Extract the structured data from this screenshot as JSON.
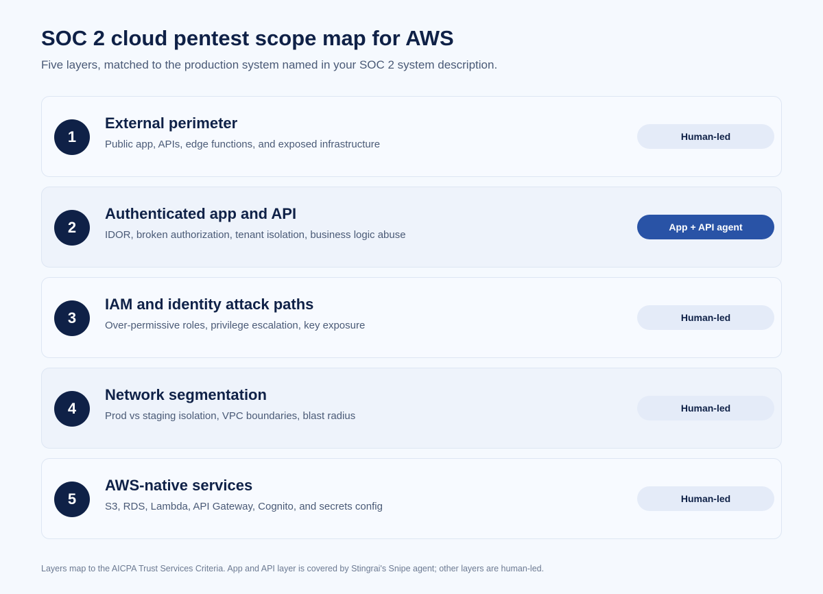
{
  "header": {
    "title": "SOC 2 cloud pentest scope map for AWS",
    "subtitle": "Five layers, matched to the production system named in your SOC 2 system description."
  },
  "layers": [
    {
      "number": "1",
      "title": "External perimeter",
      "description": "Public app, APIs, edge functions, and exposed infrastructure",
      "tag": "Human-led"
    },
    {
      "number": "2",
      "title": "Authenticated app and API",
      "description": "IDOR, broken authorization, tenant isolation, business logic abuse",
      "tag": "App + API agent"
    },
    {
      "number": "3",
      "title": "IAM and identity attack paths",
      "description": "Over-permissive roles, privilege escalation, key exposure",
      "tag": "Human-led"
    },
    {
      "number": "4",
      "title": "Network segmentation",
      "description": "Prod vs staging isolation, VPC boundaries, blast radius",
      "tag": "Human-led"
    },
    {
      "number": "5",
      "title": "AWS-native services",
      "description": "S3, RDS, Lambda, API Gateway, Cognito, and secrets config",
      "tag": "Human-led"
    }
  ],
  "footnote": "Layers map to the AICPA Trust Services Criteria. App and API layer is covered by Stingrai's Snipe agent; other layers are human-led.",
  "colors": {
    "background": "#f5f9fe",
    "navy": "#0f2147",
    "accent_pill": "#2953a6",
    "neutral_pill": "#e4ebf8",
    "muted_text": "#4a5a76"
  }
}
